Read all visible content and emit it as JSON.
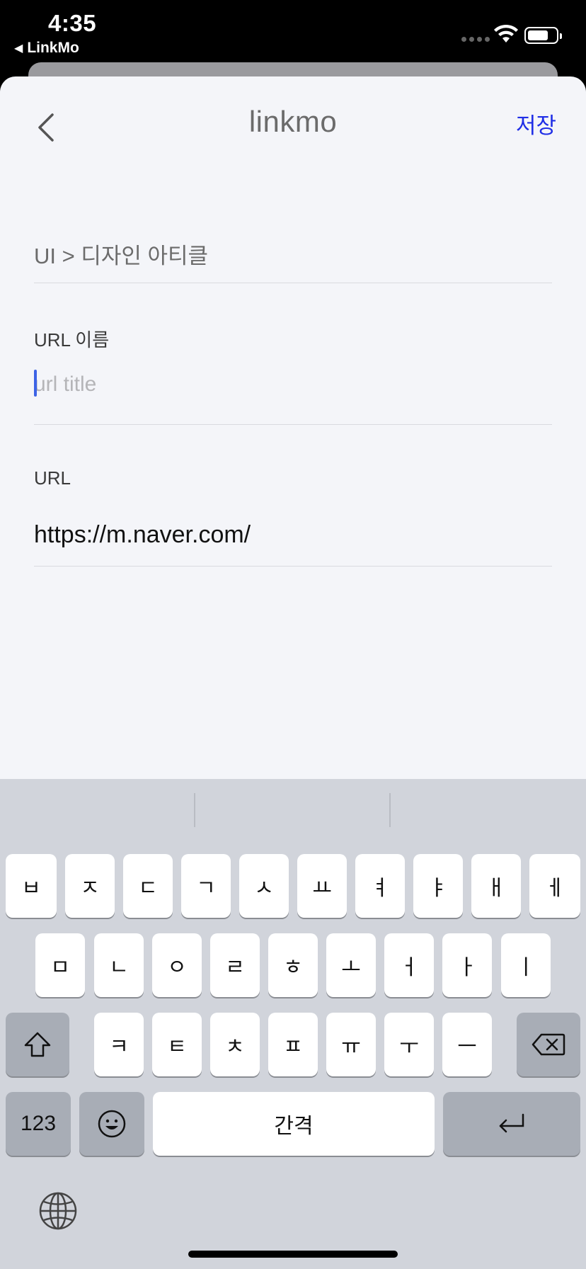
{
  "status": {
    "time": "4:35",
    "back_app": "LinkMo"
  },
  "nav": {
    "title": "linkmo",
    "save_label": "저장"
  },
  "form": {
    "category": "UI > 디자인 아티클",
    "url_name_label": "URL 이름",
    "url_name_placeholder": "url title",
    "url_label": "URL",
    "url_value": "https://m.naver.com/"
  },
  "keyboard": {
    "row1": [
      "ㅂ",
      "ㅈ",
      "ㄷ",
      "ㄱ",
      "ㅅ",
      "ㅛ",
      "ㅕ",
      "ㅑ",
      "ㅐ",
      "ㅔ"
    ],
    "row2": [
      "ㅁ",
      "ㄴ",
      "ㅇ",
      "ㄹ",
      "ㅎ",
      "ㅗ",
      "ㅓ",
      "ㅏ",
      "ㅣ"
    ],
    "row3": [
      "ㅋ",
      "ㅌ",
      "ㅊ",
      "ㅍ",
      "ㅠ",
      "ㅜ",
      "ㅡ"
    ],
    "numbers_label": "123",
    "space_label": "간격",
    "shift_symbol": "⇧",
    "emoji_symbol": "☺",
    "return_symbol": "↵"
  },
  "colors": {
    "accent": "#1f2ee6",
    "caret": "#3d63e6",
    "sheet_bg": "#f4f5f9",
    "keyboard_bg": "#d1d4db"
  }
}
